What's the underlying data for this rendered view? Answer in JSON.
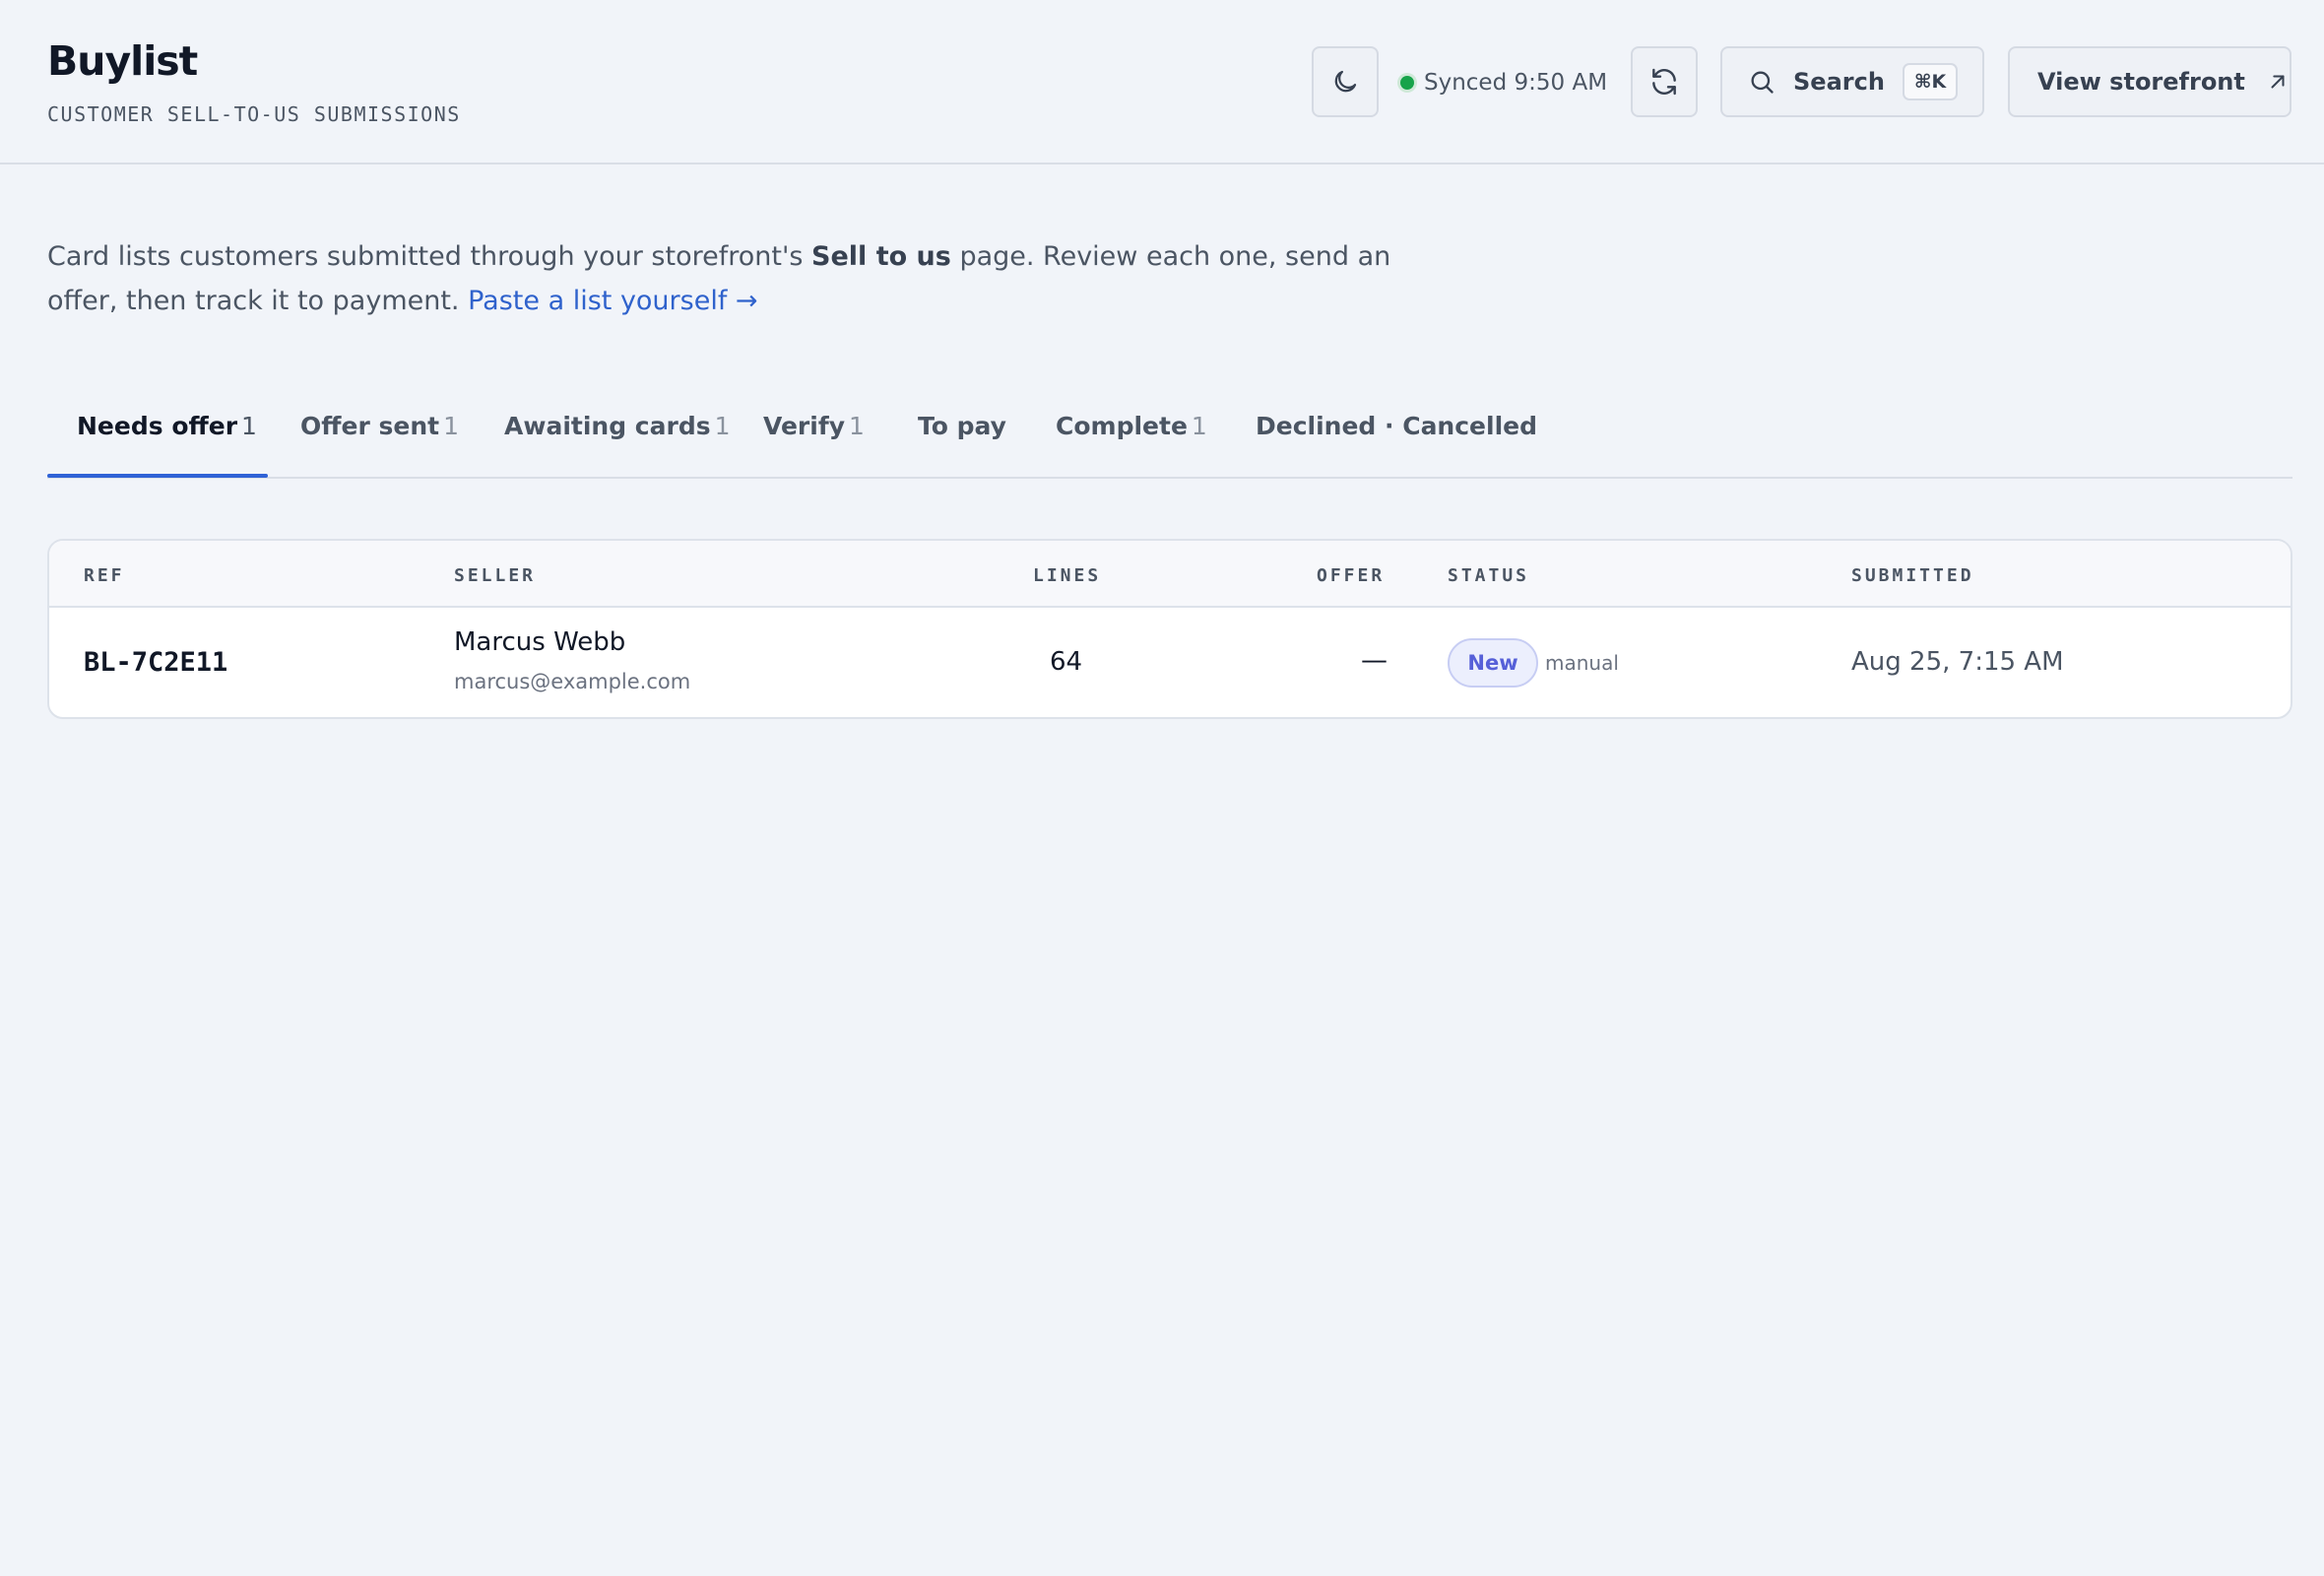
{
  "header": {
    "title": "Buylist",
    "subtitle": "CUSTOMER SELL-TO-US SUBMISSIONS",
    "theme_icon": "moon-icon",
    "sync_status": "Synced 9:50 AM",
    "sync_color": "#16a34a",
    "refresh_icon": "refresh-icon",
    "search_label": "Search",
    "search_shortcut": "⌘K",
    "storefront_label": "View storefront"
  },
  "intro": {
    "text_before": "Card lists customers submitted through your storefront's ",
    "bold": "Sell to us",
    "text_after": " page. Review each one, send an offer, then track it to payment. ",
    "link": "Paste a list yourself →"
  },
  "tabs": [
    {
      "label": "Needs offer",
      "count": "1"
    },
    {
      "label": "Offer sent",
      "count": "1"
    },
    {
      "label": "Awaiting cards",
      "count": "1"
    },
    {
      "label": "Verify",
      "count": "1"
    },
    {
      "label": "To pay",
      "count": ""
    },
    {
      "label": "Complete",
      "count": "1"
    },
    {
      "label": "Declined · Cancelled",
      "count": ""
    }
  ],
  "active_tab": "Needs offer",
  "accent_color": "#2f62d6",
  "table": {
    "columns": [
      "REF",
      "SELLER",
      "LINES",
      "OFFER",
      "STATUS",
      "SUBMITTED"
    ],
    "rows": [
      {
        "ref": "BL-7C2E11",
        "seller_name": "Marcus Webb",
        "seller_email": "marcus@example.com",
        "lines": "64",
        "offer": "—",
        "status": "New",
        "source": "manual",
        "submitted": "Aug 25, 7:15 AM"
      }
    ]
  }
}
